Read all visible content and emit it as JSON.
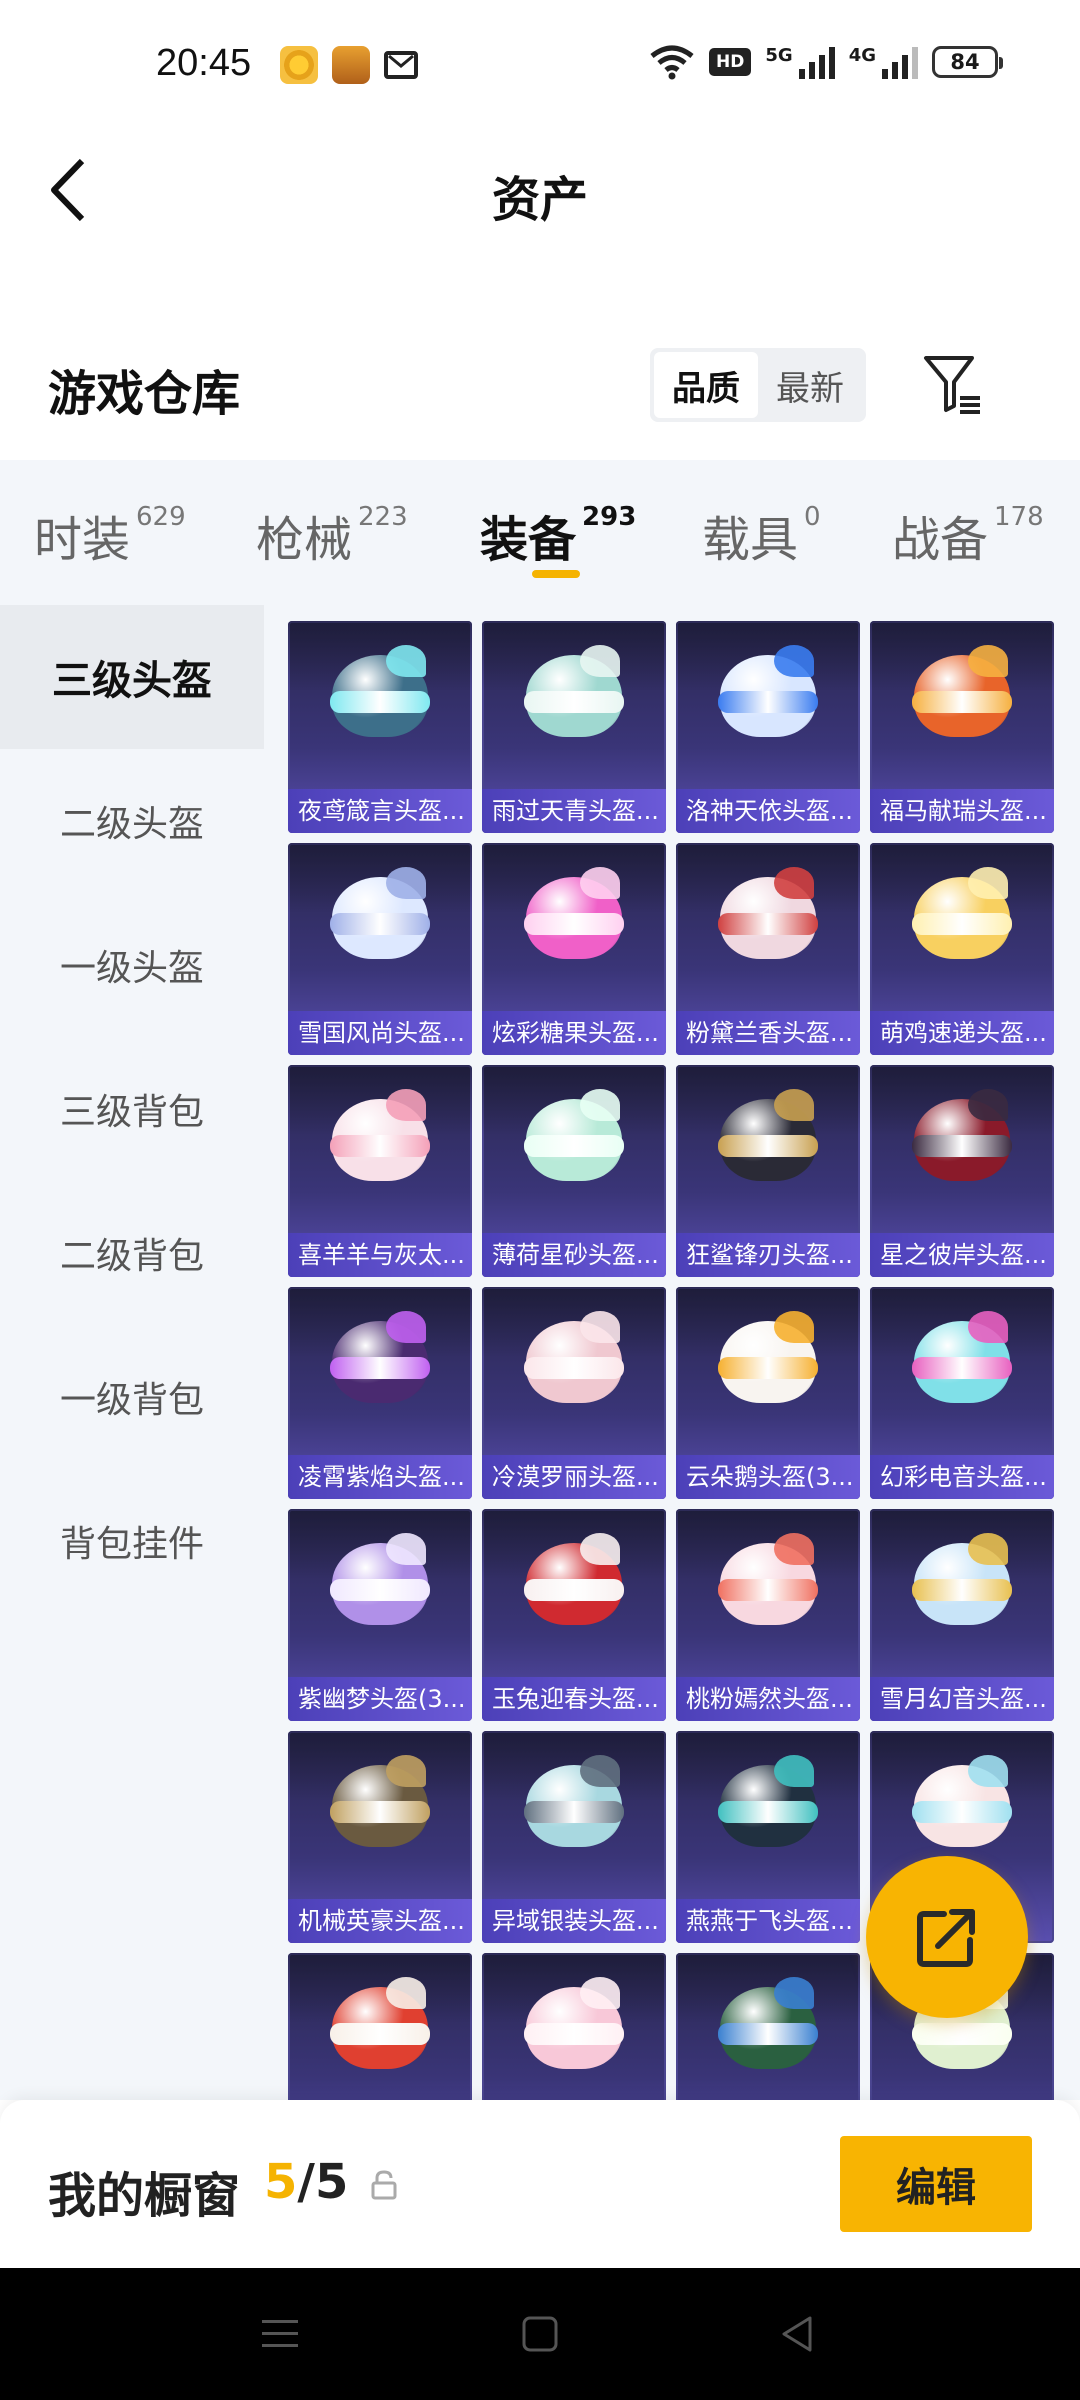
{
  "status_bar": {
    "time": "20:45",
    "network_5g": "5G",
    "network_4g": "4G",
    "hd_label": "HD",
    "battery": "84"
  },
  "header": {
    "title": "资产"
  },
  "warehouse": {
    "title": "游戏仓库",
    "sort_options": [
      "品质",
      "最新"
    ],
    "active_sort": "品质"
  },
  "categories": [
    {
      "label": "时装",
      "count": "629"
    },
    {
      "label": "枪械",
      "count": "223"
    },
    {
      "label": "装备",
      "count": "293"
    },
    {
      "label": "载具",
      "count": "0"
    },
    {
      "label": "战备",
      "count": "178"
    }
  ],
  "active_category": "装备",
  "sidebar": {
    "items": [
      "三级头盔",
      "二级头盔",
      "一级头盔",
      "三级背包",
      "二级背包",
      "一级背包",
      "背包挂件"
    ],
    "active": "三级头盔"
  },
  "items": [
    {
      "name": "夜鸢箴言头盔...",
      "color": "#3d6f8a",
      "accent": "#7fe8f0"
    },
    {
      "name": "雨过天青头盔...",
      "color": "#9fd8d0",
      "accent": "#e8f6f2"
    },
    {
      "name": "洛神天依头盔...",
      "color": "#d8e6ff",
      "accent": "#3a7cf0"
    },
    {
      "name": "福马献瑞头盔...",
      "color": "#e8642a",
      "accent": "#f6b040"
    },
    {
      "name": "雪国风尚头盔...",
      "color": "#dde8ff",
      "accent": "#9fb0e8"
    },
    {
      "name": "炫彩糖果头盔...",
      "color": "#f060c8",
      "accent": "#ffd0f0"
    },
    {
      "name": "粉黛兰香头盔...",
      "color": "#f0d8e0",
      "accent": "#d04040"
    },
    {
      "name": "萌鸡速递头盔...",
      "color": "#f8d060",
      "accent": "#fff0b0"
    },
    {
      "name": "喜羊羊与灰太...",
      "color": "#f8e0e8",
      "accent": "#f4a0b8"
    },
    {
      "name": "薄荷星砂头盔...",
      "color": "#b8ead8",
      "accent": "#e8fff4"
    },
    {
      "name": "狂鲨锋刃头盔...",
      "color": "#2a2a36",
      "accent": "#c8a050"
    },
    {
      "name": "星之彼岸头盔...",
      "color": "#8a1a2a",
      "accent": "#3a2a40"
    },
    {
      "name": "凌霄紫焰头盔...",
      "color": "#4a2a70",
      "accent": "#c060f0"
    },
    {
      "name": "冷漠罗丽头盔...",
      "color": "#f0c8d0",
      "accent": "#fbe6ea"
    },
    {
      "name": "云朵鹅头盔(3...",
      "color": "#f8f4f0",
      "accent": "#f6b030"
    },
    {
      "name": "幻彩电音头盔...",
      "color": "#80e0e8",
      "accent": "#e860c0"
    },
    {
      "name": "紫幽梦头盔(3...",
      "color": "#b090e8",
      "accent": "#f0e8ff"
    },
    {
      "name": "玉兔迎春头盔...",
      "color": "#d02a30",
      "accent": "#f8f0f0"
    },
    {
      "name": "桃粉嫣然头盔...",
      "color": "#f8d8e0",
      "accent": "#f07060"
    },
    {
      "name": "雪月幻音头盔...",
      "color": "#c8e4f8",
      "accent": "#e8c050"
    },
    {
      "name": "机械英豪头盔...",
      "color": "#6a5a40",
      "accent": "#c0a060"
    },
    {
      "name": "异域银装头盔...",
      "color": "#a8d8e0",
      "accent": "#607080"
    },
    {
      "name": "燕燕于飞头盔...",
      "color": "#203040",
      "accent": "#40c0c0"
    },
    {
      "name": "",
      "color": "#f8e4e4",
      "accent": "#a0e0f0"
    },
    {
      "name": "",
      "color": "#e04030",
      "accent": "#f8f0e8"
    },
    {
      "name": "",
      "color": "#f8c8d8",
      "accent": "#fff0f4"
    },
    {
      "name": "",
      "color": "#2a6040",
      "accent": "#3a80d0"
    },
    {
      "name": "",
      "color": "#e0f0d0",
      "accent": "#fafff0"
    }
  ],
  "showcase": {
    "label": "我的橱窗",
    "current": "5",
    "separator": "/",
    "max": "5",
    "edit_label": "编辑"
  },
  "colors": {
    "accent": "#f8b402",
    "card_bg": "#3a3578",
    "name_bar": "#5a4ad0"
  }
}
